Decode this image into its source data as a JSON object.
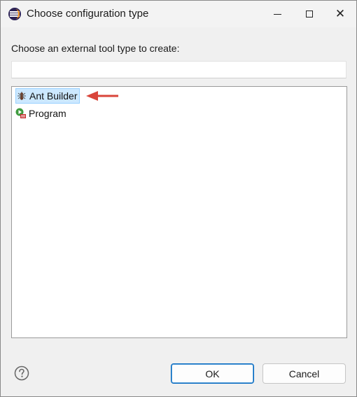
{
  "window": {
    "title": "Choose configuration type",
    "icon": "eclipse-icon",
    "controls": {
      "minimize_icon": "minimize-icon",
      "maximize_icon": "maximize-icon",
      "close_icon": "close-icon",
      "close_glyph": "✕"
    }
  },
  "dialog": {
    "prompt": "Choose an external tool type to create:",
    "filter": {
      "value": "",
      "placeholder": ""
    },
    "tree": {
      "items": [
        {
          "label": "Ant Builder",
          "icon": "ant-icon",
          "selected": true
        },
        {
          "label": "Program",
          "icon": "program-icon",
          "selected": false
        }
      ]
    },
    "annotation": {
      "icon": "red-arrow-icon",
      "color": "#d9453a"
    }
  },
  "footer": {
    "help_icon": "help-icon",
    "ok_label": "OK",
    "cancel_label": "Cancel"
  },
  "colors": {
    "selection_bg": "#cce8ff",
    "selection_border": "#99d1ff",
    "default_button_border": "#0067c0",
    "dialog_bg": "#f0f0f0"
  }
}
